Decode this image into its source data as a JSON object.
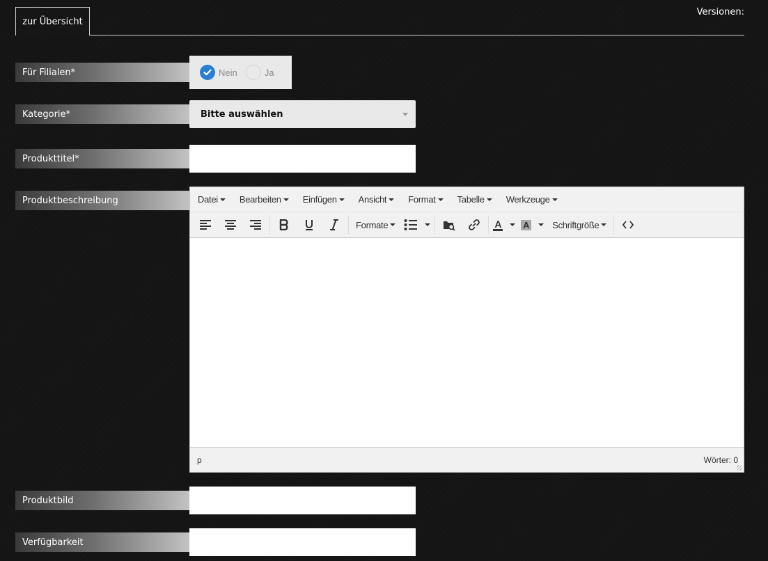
{
  "header": {
    "back_label": "zur Übersicht",
    "versions_label": "Versionen:"
  },
  "form": {
    "filialen": {
      "label": "Für Filialen*",
      "options": [
        "Nein",
        "Ja"
      ],
      "selected": "Nein"
    },
    "kategorie": {
      "label": "Kategorie*",
      "value": "Bitte auswählen"
    },
    "produkttitel": {
      "label": "Produkttitel*",
      "value": ""
    },
    "produktbeschreibung": {
      "label": "Produktbeschreibung"
    },
    "produktbild": {
      "label": "Produktbild",
      "value": ""
    },
    "verfuegbarkeit": {
      "label": "Verfügbarkeit",
      "value": ""
    }
  },
  "editor": {
    "menu": [
      "Datei",
      "Bearbeiten",
      "Einfügen",
      "Ansicht",
      "Format",
      "Tabelle",
      "Werkzeuge"
    ],
    "toolbar": {
      "formats_label": "Formate",
      "fontsize_label": "Schriftgröße",
      "text_color_glyph": "A",
      "bg_color_glyph": "A"
    },
    "status": {
      "path": "p",
      "wordcount": "Wörter: 0"
    }
  },
  "colors": {
    "accent": "#2a7fd4",
    "background": "#161616"
  },
  "icons": [
    "check-icon",
    "align-left-icon",
    "align-center-icon",
    "align-right-icon",
    "bold-icon",
    "underline-icon",
    "italic-icon",
    "bullet-list-icon",
    "media-icon",
    "link-icon",
    "text-color-icon",
    "background-color-icon",
    "code-icon"
  ]
}
